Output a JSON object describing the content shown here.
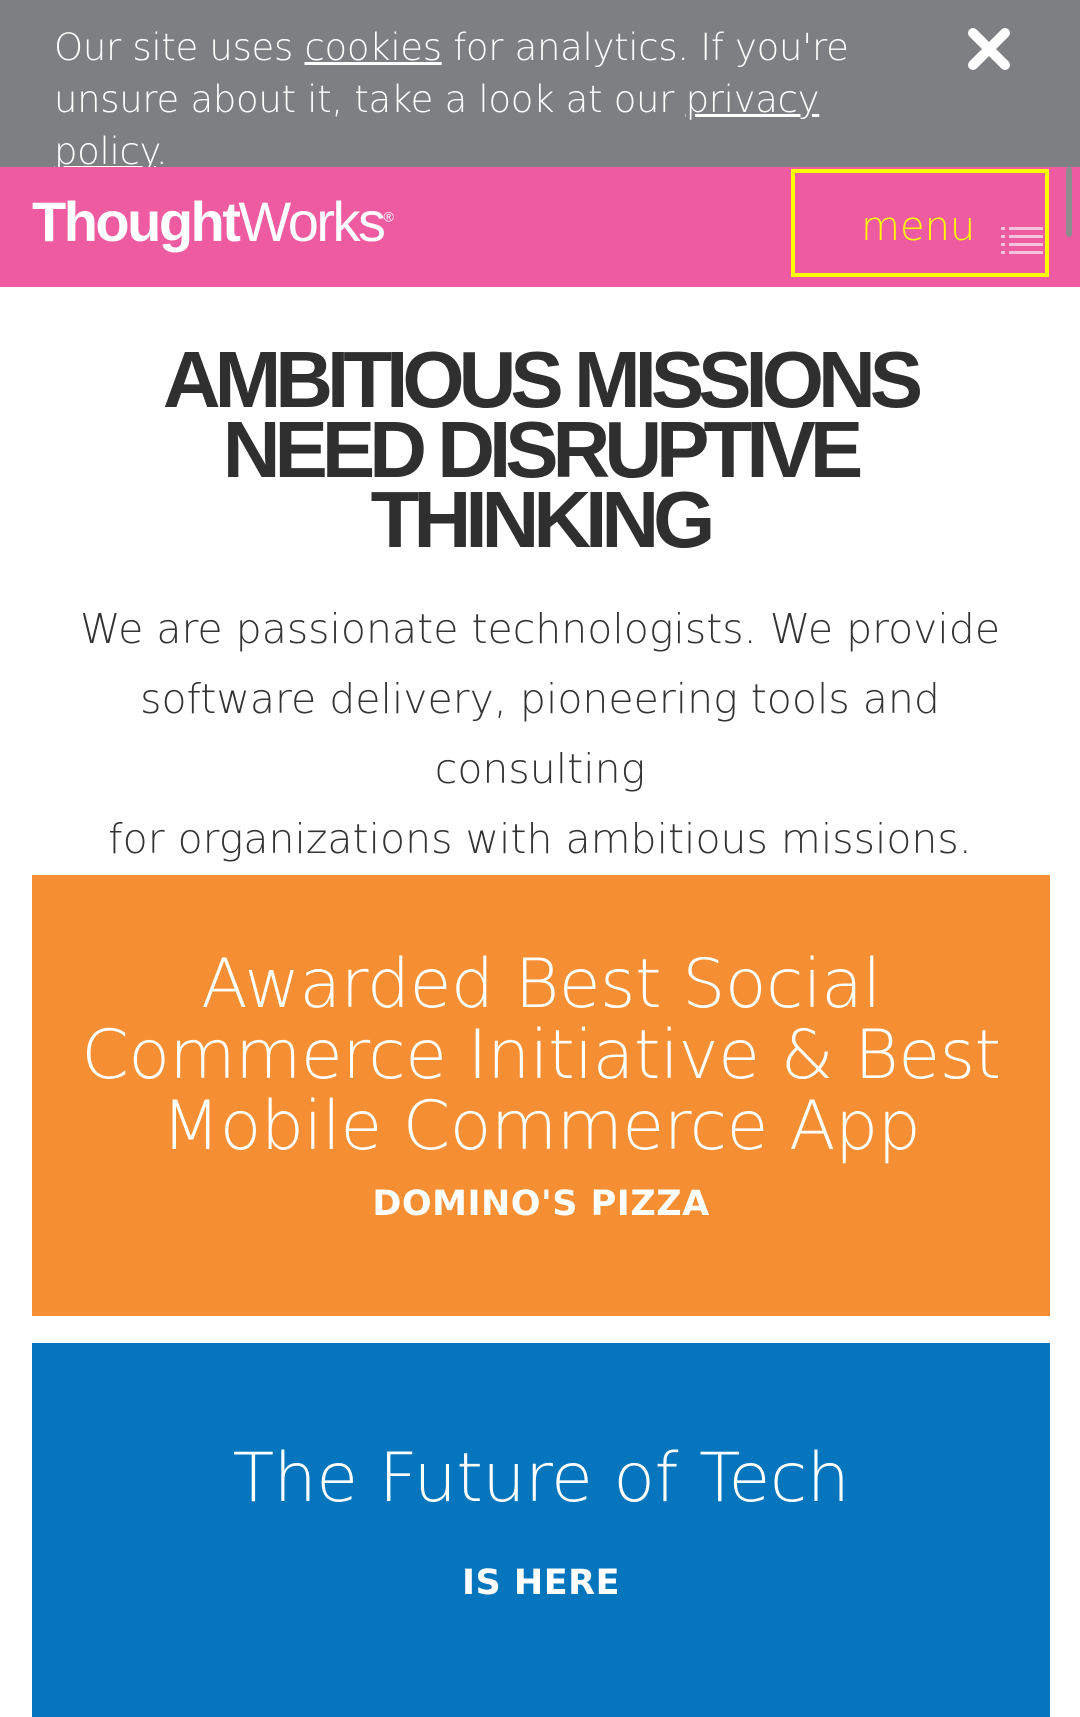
{
  "cookie_banner": {
    "text_before_cookies": "Our site uses ",
    "cookies_link": "cookies",
    "text_middle": " for analytics. If you're unsure about it, take a look at our ",
    "privacy_link": "privacy policy",
    "text_after": ".",
    "close_icon": "close-icon"
  },
  "header": {
    "logo_part1": "Thought",
    "logo_part2": "Works",
    "logo_mark": "®",
    "menu_label": "menu",
    "menu_icon": "hamburger-icon",
    "colors": {
      "background": "#ee5ba0",
      "menu_highlight": "#ffff00"
    }
  },
  "hero": {
    "title_lines": [
      "AMBITIOUS MISSIONS",
      "NEED DISRUPTIVE",
      "THINKING"
    ],
    "subtitle_lines": [
      "We are passionate technologists. We provide",
      "software delivery, pioneering tools and consulting",
      "for organizations with ambitious missions."
    ]
  },
  "promos": [
    {
      "heading_lines": [
        "Awarded Best Social",
        "Commerce Initiative & Best",
        "Mobile Commerce App"
      ],
      "subtext": "DOMINO'S PIZZA",
      "color": "#f68f34"
    },
    {
      "heading_lines": [
        "The Future of Tech"
      ],
      "subtext": "IS HERE",
      "color": "#0575bd"
    }
  ]
}
